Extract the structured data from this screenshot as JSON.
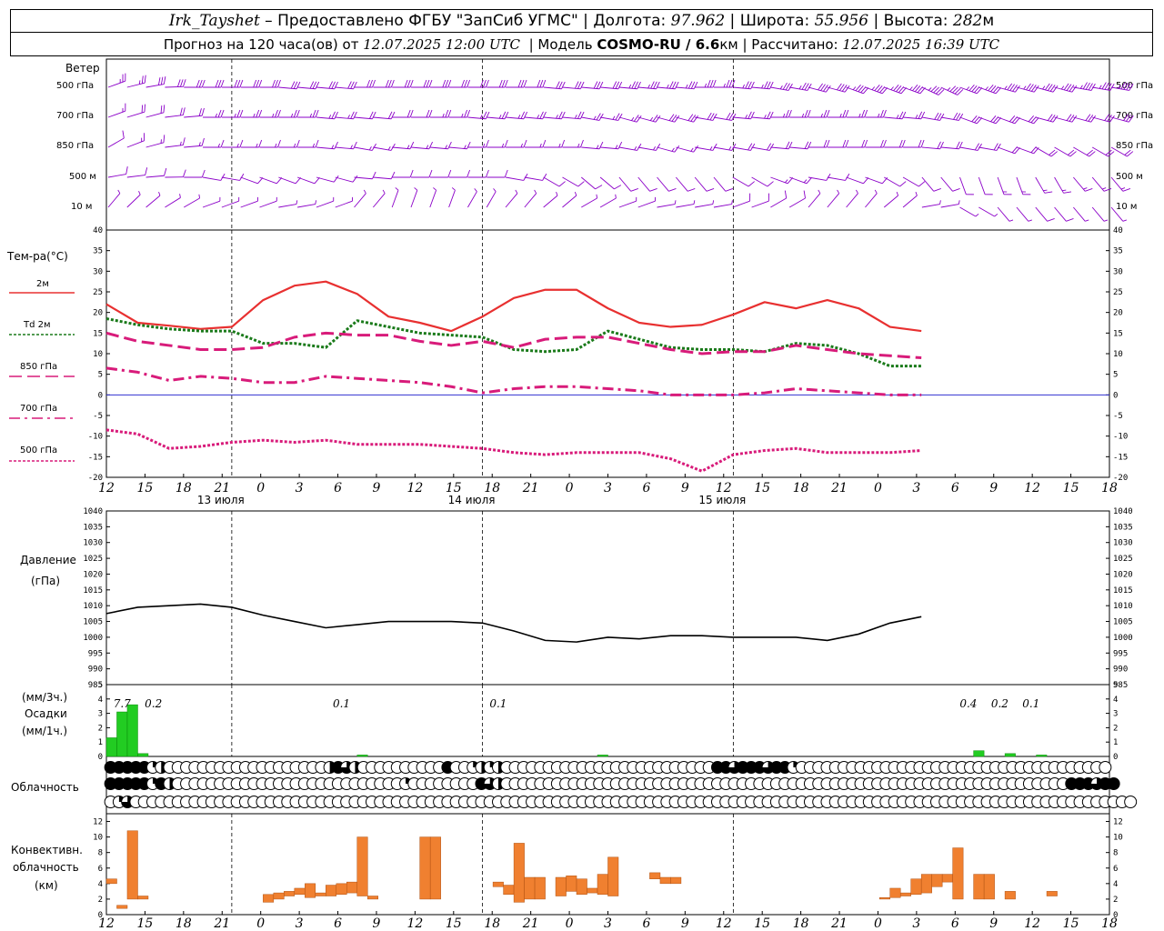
{
  "header": {
    "station": "Irk_Tayshet",
    "dash": " – ",
    "provider": "Предоставлено ФГБУ \"ЗапСиб УГМС\"",
    "lon_label": "Долгота:",
    "lon": "97.962",
    "lat_label": "Широта:",
    "lat": "55.956",
    "alt_label": "Высота:",
    "alt": "282",
    "alt_unit": "м",
    "forecast_prefix": "Прогноз на 120 часа(ов) от",
    "forecast_start": "12.07.2025 12:00 UTC",
    "model_label": "Модель",
    "model": "COSMO-RU / 6.6",
    "model_unit": "км",
    "computed_label": "Рассчитано:",
    "computed": "12.07.2025 16:39 UTC"
  },
  "labels": {
    "wind": "Ветер",
    "wind_levels": [
      "500 гПа",
      "700 гПа",
      "850 гПа",
      "500 м",
      "10  м"
    ],
    "temp_title": "Тем-ра(°С)",
    "temp_legend": [
      "2м",
      "Td  2м",
      "850 гПа",
      "700 гПа",
      "500 гПа"
    ],
    "pressure_title": "Давление",
    "pressure_unit": "(гПа)",
    "precip_3h": "(мм/3ч.)",
    "precip_title": "Осадки",
    "precip_1h": "(мм/1ч.)",
    "clouds": "Облачность",
    "conv1": "Конвективн.",
    "conv2": "облачность",
    "conv_unit": "(км)"
  },
  "colors": {
    "wind": "#8b00c8",
    "t2m": "#e83030",
    "td2m": "#1a7a1a",
    "t850": "#d81b7a",
    "precip": "#22cc22",
    "convective": "#f08030",
    "zero_line": "#3030d0"
  },
  "chart_data": {
    "type": "meteogram",
    "time_ticks": [
      "12",
      "15",
      "18",
      "21",
      "0",
      "3",
      "6",
      "9",
      "12",
      "15",
      "18",
      "21",
      "0",
      "3",
      "6",
      "9",
      "12",
      "15",
      "18",
      "21",
      "0",
      "3",
      "6",
      "9",
      "12",
      "15",
      "18"
    ],
    "day_labels": [
      "13 июля",
      "14 июля",
      "15 июля"
    ],
    "day_label_hours": [
      12,
      36,
      60
    ],
    "midnight_hours": [
      12,
      36,
      60
    ],
    "hours": [
      0,
      3,
      6,
      9,
      12,
      15,
      18,
      21,
      24,
      27,
      30,
      33,
      36,
      39,
      42,
      45,
      48,
      51,
      54,
      57,
      60,
      63,
      66,
      69,
      72,
      75,
      78
    ],
    "temperature": {
      "ylim": [
        -20,
        40
      ],
      "yticks": [
        -20,
        -15,
        -10,
        -5,
        0,
        5,
        10,
        15,
        20,
        25,
        30,
        35,
        40
      ],
      "series": [
        {
          "name": "2м",
          "style": "solid",
          "color": "#e83030",
          "values": [
            22,
            17.5,
            16.8,
            16,
            16.5,
            23,
            26.5,
            27.5,
            24.5,
            19,
            17.5,
            15.5,
            19,
            23.5,
            25.5,
            25.5,
            21,
            17.5,
            16.5,
            17,
            19.5,
            22.5,
            21,
            23,
            21,
            16.5,
            15.5
          ]
        },
        {
          "name": "Td  2м",
          "style": "dotted",
          "color": "#1a7a1a",
          "values": [
            18.5,
            17,
            16,
            15.5,
            15.5,
            12.5,
            12.5,
            11.5,
            18,
            16.5,
            15,
            14.5,
            14,
            11,
            10.5,
            11,
            15.5,
            13.5,
            11.5,
            11,
            11,
            10.5,
            12.5,
            12,
            10,
            7,
            7
          ]
        },
        {
          "name": "850 гПа",
          "style": "dashed",
          "color": "#d81b7a",
          "values": [
            15,
            13,
            12,
            11,
            11,
            11.5,
            14,
            15,
            14.5,
            14.5,
            13,
            12,
            13,
            11.5,
            13.5,
            14,
            14,
            12.5,
            11,
            10,
            10.5,
            10.5,
            12,
            11,
            10,
            9.5,
            9
          ]
        },
        {
          "name": "700 гПа",
          "style": "dashdot",
          "color": "#d81b7a",
          "values": [
            6.5,
            5.5,
            3.5,
            4.5,
            4,
            3,
            3,
            4.5,
            4,
            3.5,
            3,
            2,
            0.5,
            1.5,
            2,
            2,
            1.5,
            1,
            0,
            0,
            0,
            0.5,
            1.5,
            1,
            0.5,
            0,
            0
          ]
        },
        {
          "name": "500 гПа",
          "style": "dotted",
          "color": "#d81b7a",
          "values": [
            -8.5,
            -9.5,
            -13,
            -12.5,
            -11.5,
            -11,
            -11.5,
            -11,
            -12,
            -12,
            -12,
            -12.5,
            -13,
            -14,
            -14.5,
            -14,
            -14,
            -14,
            -15.5,
            -18.5,
            -14.5,
            -13.5,
            -13,
            -14,
            -14,
            -14,
            -13.5
          ]
        }
      ]
    },
    "pressure": {
      "ylim": [
        985,
        1040
      ],
      "yticks": [
        985,
        990,
        995,
        1000,
        1005,
        1010,
        1015,
        1020,
        1025,
        1030,
        1035,
        1040
      ],
      "values": [
        1007.5,
        1009.5,
        1010,
        1010.5,
        1009.5,
        1007,
        1005,
        1003,
        1004,
        1005,
        1005,
        1005,
        1004.5,
        1002,
        999,
        998.5,
        1000,
        999.5,
        1000.5,
        1000.5,
        1000,
        1000,
        1000,
        999,
        1001,
        1004.5,
        1006.5
      ]
    },
    "precipitation": {
      "ylim": [
        0,
        5
      ],
      "yticks": [
        0,
        1,
        2,
        3,
        4,
        5
      ],
      "bar_hours": [
        0,
        1,
        2,
        3,
        24,
        47,
        83,
        86,
        89
      ],
      "bar_values": [
        1.3,
        3.1,
        3.6,
        0.2,
        0.1,
        0.1,
        0.4,
        0.2,
        0.1
      ],
      "totals_3h": [
        {
          "hour": 1.5,
          "label": "7.7"
        },
        {
          "hour": 4.5,
          "label": "0.2"
        },
        {
          "hour": 22.5,
          "label": "0.1"
        },
        {
          "hour": 37.5,
          "label": "0.1"
        },
        {
          "hour": 82.5,
          "label": "0.4"
        },
        {
          "hour": 85.5,
          "label": "0.2"
        },
        {
          "hour": 88.5,
          "label": "0.1"
        }
      ]
    },
    "cloudiness_eighths": [
      [
        8,
        8,
        8,
        8,
        8,
        2,
        4,
        0,
        0,
        0,
        0,
        0,
        0,
        0,
        0,
        0,
        0,
        0,
        0,
        0,
        0,
        0,
        0,
        0,
        0,
        0,
        4,
        8,
        6,
        4,
        0,
        0,
        0,
        0,
        0,
        0,
        0,
        0,
        0,
        0,
        8,
        0,
        0,
        2,
        4,
        2,
        4,
        0,
        0,
        0,
        0,
        0,
        0,
        0,
        0,
        0,
        0,
        0,
        0,
        0,
        0,
        0,
        0,
        0,
        0,
        0,
        0,
        0,
        0,
        0,
        0,
        0,
        8,
        8,
        6,
        8,
        8,
        8,
        6,
        8,
        8,
        2,
        0,
        0,
        0,
        0,
        0,
        0,
        0,
        0,
        0,
        0,
        0,
        0,
        0,
        0,
        0,
        0,
        0,
        0,
        0,
        0,
        0,
        0,
        0,
        0,
        0,
        0,
        0,
        0,
        0,
        0,
        0,
        0,
        0,
        0,
        0,
        0,
        0
      ],
      [
        8,
        8,
        8,
        8,
        8,
        2,
        8,
        4,
        0,
        0,
        0,
        0,
        0,
        0,
        0,
        0,
        0,
        0,
        0,
        0,
        0,
        0,
        0,
        0,
        0,
        0,
        0,
        0,
        0,
        0,
        0,
        0,
        0,
        0,
        0,
        2,
        0,
        0,
        0,
        0,
        0,
        0,
        0,
        0,
        8,
        6,
        4,
        0,
        0,
        0,
        0,
        0,
        0,
        0,
        0,
        0,
        0,
        0,
        0,
        0,
        0,
        0,
        0,
        0,
        0,
        0,
        0,
        0,
        0,
        0,
        0,
        0,
        0,
        0,
        0,
        0,
        0,
        0,
        0,
        0,
        0,
        0,
        0,
        0,
        0,
        0,
        0,
        0,
        0,
        0,
        0,
        0,
        0,
        0,
        0,
        0,
        0,
        0,
        0,
        0,
        0,
        0,
        0,
        0,
        0,
        0,
        0,
        0,
        0,
        0,
        0,
        0,
        0,
        0,
        8,
        8,
        8,
        6,
        8,
        8
      ],
      [
        0,
        2,
        6,
        0,
        0,
        0,
        0,
        0,
        0,
        0,
        0,
        0,
        0,
        0,
        0,
        0,
        0,
        0,
        0,
        0,
        0,
        0,
        0,
        0,
        0,
        0,
        0,
        0,
        0,
        0,
        0,
        0,
        0,
        0,
        0,
        0,
        0,
        0,
        0,
        0,
        0,
        0,
        0,
        0,
        0,
        0,
        0,
        0,
        0,
        0,
        0,
        0,
        0,
        0,
        0,
        0,
        0,
        0,
        0,
        0,
        0,
        0,
        0,
        0,
        0,
        0,
        0,
        0,
        0,
        0,
        0,
        0,
        0,
        0,
        0,
        0,
        0,
        0,
        0,
        0,
        0,
        0,
        0,
        0,
        0,
        0,
        0,
        0,
        0,
        0,
        0,
        0,
        0,
        0,
        0,
        0,
        0,
        0,
        0,
        0,
        0,
        0,
        0,
        0,
        0,
        0,
        0,
        0,
        0,
        0,
        0,
        0,
        0,
        0,
        0,
        0,
        0,
        0,
        0,
        0,
        0,
        0
      ]
    ],
    "convective": {
      "ylim": [
        0,
        13
      ],
      "yticks": [
        0,
        2,
        4,
        6,
        8,
        10,
        12
      ],
      "bars": [
        {
          "hour": 0,
          "base": 4,
          "top": 4.6
        },
        {
          "hour": 1,
          "base": 0.8,
          "top": 1.2
        },
        {
          "hour": 2,
          "base": 2,
          "top": 10.8
        },
        {
          "hour": 3,
          "base": 2,
          "top": 2.4
        },
        {
          "hour": 15,
          "base": 1.6,
          "top": 2.6
        },
        {
          "hour": 16,
          "base": 2,
          "top": 2.8
        },
        {
          "hour": 17,
          "base": 2.4,
          "top": 3.0
        },
        {
          "hour": 18,
          "base": 2.6,
          "top": 3.4
        },
        {
          "hour": 19,
          "base": 2.2,
          "top": 4.0
        },
        {
          "hour": 20,
          "base": 2.4,
          "top": 2.8
        },
        {
          "hour": 21,
          "base": 2.4,
          "top": 3.8
        },
        {
          "hour": 22,
          "base": 2.6,
          "top": 4.0
        },
        {
          "hour": 23,
          "base": 2.8,
          "top": 4.2
        },
        {
          "hour": 24,
          "base": 2.4,
          "top": 10.0
        },
        {
          "hour": 25,
          "base": 2.0,
          "top": 2.4
        },
        {
          "hour": 30,
          "base": 2.0,
          "top": 10.0
        },
        {
          "hour": 31,
          "base": 2.0,
          "top": 10.0
        },
        {
          "hour": 37,
          "base": 3.6,
          "top": 4.2
        },
        {
          "hour": 38,
          "base": 2.6,
          "top": 3.8
        },
        {
          "hour": 39,
          "base": 1.6,
          "top": 9.2
        },
        {
          "hour": 40,
          "base": 2.0,
          "top": 4.8
        },
        {
          "hour": 41,
          "base": 2.0,
          "top": 4.8
        },
        {
          "hour": 43,
          "base": 2.4,
          "top": 4.8
        },
        {
          "hour": 44,
          "base": 3.0,
          "top": 5.0
        },
        {
          "hour": 45,
          "base": 2.6,
          "top": 4.6
        },
        {
          "hour": 46,
          "base": 2.8,
          "top": 3.4
        },
        {
          "hour": 47,
          "base": 2.6,
          "top": 5.2
        },
        {
          "hour": 48,
          "base": 2.4,
          "top": 7.4
        },
        {
          "hour": 52,
          "base": 4.6,
          "top": 5.4
        },
        {
          "hour": 53,
          "base": 4.0,
          "top": 4.8
        },
        {
          "hour": 54,
          "base": 4.0,
          "top": 4.8
        },
        {
          "hour": 74,
          "base": 2.0,
          "top": 2.2
        },
        {
          "hour": 75,
          "base": 2.2,
          "top": 3.4
        },
        {
          "hour": 76,
          "base": 2.4,
          "top": 2.8
        },
        {
          "hour": 77,
          "base": 2.6,
          "top": 4.6
        },
        {
          "hour": 78,
          "base": 2.8,
          "top": 5.2
        },
        {
          "hour": 79,
          "base": 3.6,
          "top": 5.2
        },
        {
          "hour": 80,
          "base": 4.2,
          "top": 5.2
        },
        {
          "hour": 81,
          "base": 2.0,
          "top": 8.6
        },
        {
          "hour": 83,
          "base": 2.0,
          "top": 5.2
        },
        {
          "hour": 84,
          "base": 2.0,
          "top": 5.2
        },
        {
          "hour": 86,
          "base": 2.0,
          "top": 3.0
        },
        {
          "hour": 90,
          "base": 2.4,
          "top": 3.0
        }
      ]
    },
    "wind": {
      "levels": [
        "500 гПа",
        "700 гПа",
        "850 гПа",
        "500 м",
        "10  м"
      ],
      "hours": [
        0,
        3,
        6,
        9,
        12,
        15,
        18,
        21,
        24,
        27,
        30,
        33,
        36,
        39,
        42,
        45,
        48,
        51,
        54,
        57,
        60,
        63,
        66,
        69,
        72,
        75,
        78
      ],
      "direction_deg": [
        [
          250,
          260,
          270,
          270,
          270,
          275,
          275,
          270,
          270,
          270,
          270,
          270,
          275,
          275,
          275,
          275,
          270,
          275,
          280,
          285,
          290,
          290,
          295,
          290,
          285,
          285,
          280
        ],
        [
          250,
          255,
          265,
          270,
          270,
          270,
          275,
          275,
          270,
          270,
          275,
          275,
          275,
          280,
          285,
          285,
          280,
          275,
          270,
          270,
          270,
          275,
          280,
          290,
          290,
          285,
          285
        ],
        [
          240,
          255,
          265,
          270,
          270,
          270,
          275,
          280,
          275,
          275,
          270,
          270,
          270,
          275,
          280,
          285,
          280,
          280,
          275,
          270,
          270,
          270,
          275,
          280,
          290,
          300,
          300
        ],
        [
          260,
          265,
          270,
          280,
          290,
          290,
          285,
          275,
          270,
          270,
          270,
          280,
          300,
          310,
          320,
          320,
          320,
          300,
          290,
          280,
          290,
          300,
          320,
          340,
          340,
          330,
          320
        ],
        [
          220,
          230,
          240,
          250,
          250,
          260,
          250,
          220,
          200,
          200,
          210,
          220,
          230,
          240,
          250,
          260,
          260,
          250,
          240,
          220,
          220,
          230,
          260,
          300,
          320,
          320,
          320
        ]
      ],
      "speed_ms": [
        [
          12,
          14,
          16,
          16,
          15,
          16,
          16,
          15,
          15,
          16,
          16,
          15,
          15,
          16,
          17,
          18,
          18,
          17,
          18,
          20,
          22,
          22,
          22,
          22,
          22,
          23,
          22
        ],
        [
          8,
          10,
          11,
          12,
          12,
          12,
          12,
          11,
          11,
          12,
          12,
          12,
          12,
          12,
          13,
          14,
          14,
          13,
          13,
          13,
          13,
          13,
          14,
          14,
          15,
          15,
          14
        ],
        [
          6,
          7,
          8,
          8,
          8,
          8,
          7,
          7,
          7,
          8,
          8,
          8,
          8,
          8,
          8,
          8,
          8,
          9,
          9,
          9,
          9,
          9,
          10,
          10,
          10,
          10,
          10
        ],
        [
          4,
          5,
          6,
          6,
          6,
          6,
          5,
          4,
          4,
          5,
          5,
          5,
          5,
          5,
          5,
          5,
          5,
          6,
          7,
          6,
          6,
          6,
          6,
          6,
          7,
          8,
          8
        ],
        [
          2,
          2,
          2,
          2,
          2,
          2,
          2,
          2,
          2,
          2,
          2,
          3,
          3,
          3,
          3,
          3,
          3,
          4,
          4,
          3,
          3,
          3,
          3,
          3,
          3,
          4,
          3
        ]
      ]
    }
  }
}
